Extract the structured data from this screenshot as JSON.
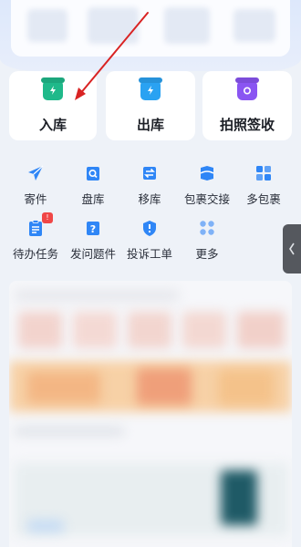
{
  "colors": {
    "primary_blue": "#2f86f6",
    "inbound_green": "#1fb98a",
    "outbound_blue": "#2aa2f2",
    "photo_purple": "#8a55f2",
    "badge_red": "#f04747",
    "arrow_red": "#d92323"
  },
  "main_actions": [
    {
      "label": "入库",
      "icon": "inbox-in-icon"
    },
    {
      "label": "出库",
      "icon": "inbox-out-icon"
    },
    {
      "label": "拍照签收",
      "icon": "camera-icon"
    }
  ],
  "grid_row1": [
    {
      "label": "寄件",
      "icon": "send-icon"
    },
    {
      "label": "盘库",
      "icon": "inventory-check-icon"
    },
    {
      "label": "移库",
      "icon": "transfer-icon"
    },
    {
      "label": "包裹交接",
      "icon": "handover-icon"
    },
    {
      "label": "多包裹",
      "icon": "multi-package-icon"
    }
  ],
  "grid_row2": [
    {
      "label": "待办任务",
      "icon": "todo-icon",
      "badge": "!"
    },
    {
      "label": "发问题件",
      "icon": "problem-package-icon"
    },
    {
      "label": "投诉工单",
      "icon": "complaint-icon"
    },
    {
      "label": "更多",
      "icon": "more-icon"
    }
  ],
  "side_tab": {
    "glyph": "〈"
  }
}
